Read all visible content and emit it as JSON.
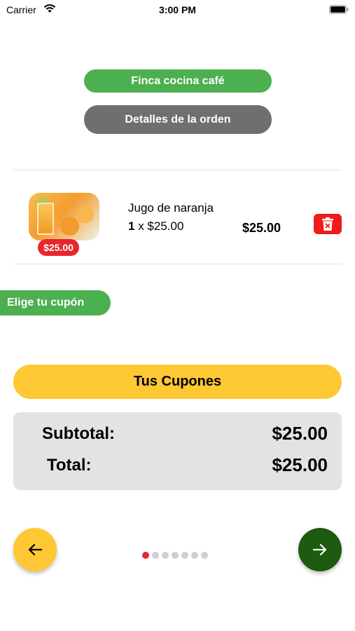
{
  "status_bar": {
    "carrier": "Carrier",
    "time": "3:00 PM",
    "icons": [
      "wifi-icon",
      "battery-icon"
    ]
  },
  "header": {
    "restaurant_name": "Finca cocina café",
    "order_details_label": "Detalles de la orden"
  },
  "order_items": [
    {
      "name": "Jugo de naranja",
      "quantity": "1",
      "separator": " x ",
      "unit_price": "$25.00",
      "line_total": "$25.00",
      "badge_price": "$25.00",
      "image_icon": "orange-juice-image",
      "delete_icon": "trash-icon"
    }
  ],
  "coupon": {
    "section_label": "Elige tu cupón",
    "button_label": "Tus Cupones"
  },
  "summary": {
    "subtotal_label": "Subtotal:",
    "subtotal_value": "$25.00",
    "total_label": "Total:",
    "total_value": "$25.00"
  },
  "navigation": {
    "back_icon": "arrow-left-icon",
    "next_icon": "arrow-right-icon",
    "page_count": 7,
    "current_page": 1
  },
  "colors": {
    "green": "#4caf50",
    "gray": "#6f6f6f",
    "yellow": "#fec734",
    "red": "#e8262e",
    "dark_green": "#1e5a10",
    "summary_bg": "#e3e3e3"
  }
}
